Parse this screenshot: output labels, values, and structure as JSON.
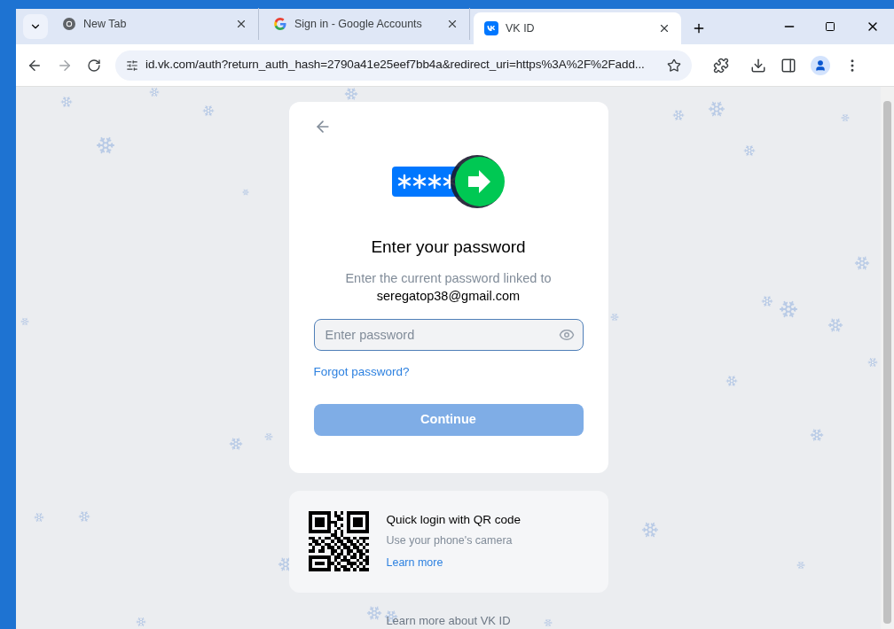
{
  "tabs": [
    {
      "title": "New Tab",
      "kind": "chrome",
      "selected": false
    },
    {
      "title": "Sign in - Google Accounts",
      "kind": "google",
      "selected": false
    },
    {
      "title": "VK ID",
      "kind": "vk",
      "selected": true
    }
  ],
  "address_bar": {
    "url": "id.vk.com/auth?return_auth_hash=2790a41e25eef7bb4a&redirect_uri=https%3A%2F%2Fadd..."
  },
  "login_card": {
    "title": "Enter your password",
    "subtitle": "Enter the current password linked to",
    "email": "seregatop38@gmail.com",
    "password_field": {
      "placeholder": "Enter password"
    },
    "forgot_link": "Forgot password?",
    "continue_button": {
      "label": "Continue",
      "disabled": true
    }
  },
  "qr_card": {
    "title": "Quick login with QR code",
    "subtitle": "Use your phone's camera",
    "link": "Learn more"
  },
  "footer_link": "Learn more about VK ID"
}
